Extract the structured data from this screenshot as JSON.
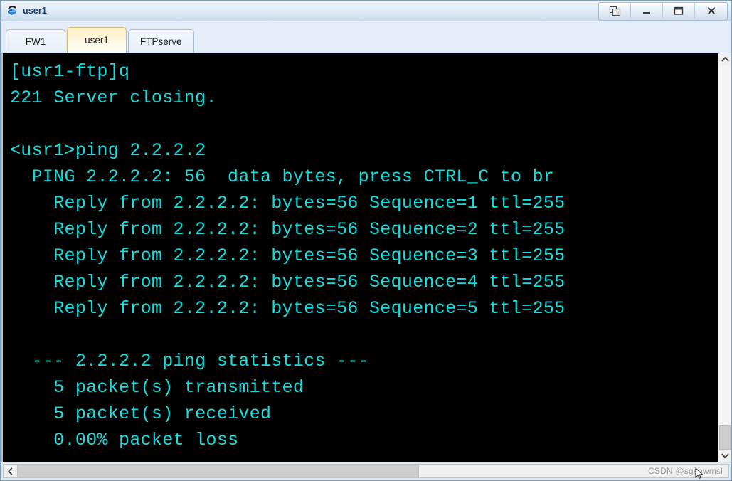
{
  "window": {
    "title": "user1",
    "icon": "router-icon",
    "buttons": [
      {
        "name": "restore-button",
        "glyph": "cascade-icon",
        "label": "Restore"
      },
      {
        "name": "minimize-button",
        "glyph": "minimize-icon",
        "label": "Minimize"
      },
      {
        "name": "maximize-button",
        "glyph": "maximize-icon",
        "label": "Maximize"
      },
      {
        "name": "close-button",
        "glyph": "close-icon",
        "label": "X"
      }
    ]
  },
  "tabs": [
    {
      "label": "FW1",
      "active": false
    },
    {
      "label": "user1",
      "active": true
    },
    {
      "label": "FTPserve",
      "active": false
    }
  ],
  "terminal": {
    "foreground": "#16dede",
    "background": "#000000",
    "lines": [
      "[usr1-ftp]q",
      "221 Server closing.",
      "",
      "<usr1>ping 2.2.2.2",
      "  PING 2.2.2.2: 56  data bytes, press CTRL_C to br",
      "    Reply from 2.2.2.2: bytes=56 Sequence=1 ttl=255",
      "    Reply from 2.2.2.2: bytes=56 Sequence=2 ttl=255",
      "    Reply from 2.2.2.2: bytes=56 Sequence=3 ttl=255",
      "    Reply from 2.2.2.2: bytes=56 Sequence=4 ttl=255",
      "    Reply from 2.2.2.2: bytes=56 Sequence=5 ttl=255",
      "",
      "  --- 2.2.2.2 ping statistics ---",
      "    5 packet(s) transmitted",
      "    5 packet(s) received",
      "    0.00% packet loss"
    ]
  },
  "scrollbars": {
    "vertical": {
      "up_arrow": "chevron-up-icon",
      "down_arrow": "chevron-down-icon",
      "thumb_position": "bottom"
    },
    "horizontal": {
      "left_arrow": "chevron-left-icon",
      "thumb_position": "left"
    }
  },
  "watermark": {
    "text": "CSDN @sgshwmsl"
  }
}
